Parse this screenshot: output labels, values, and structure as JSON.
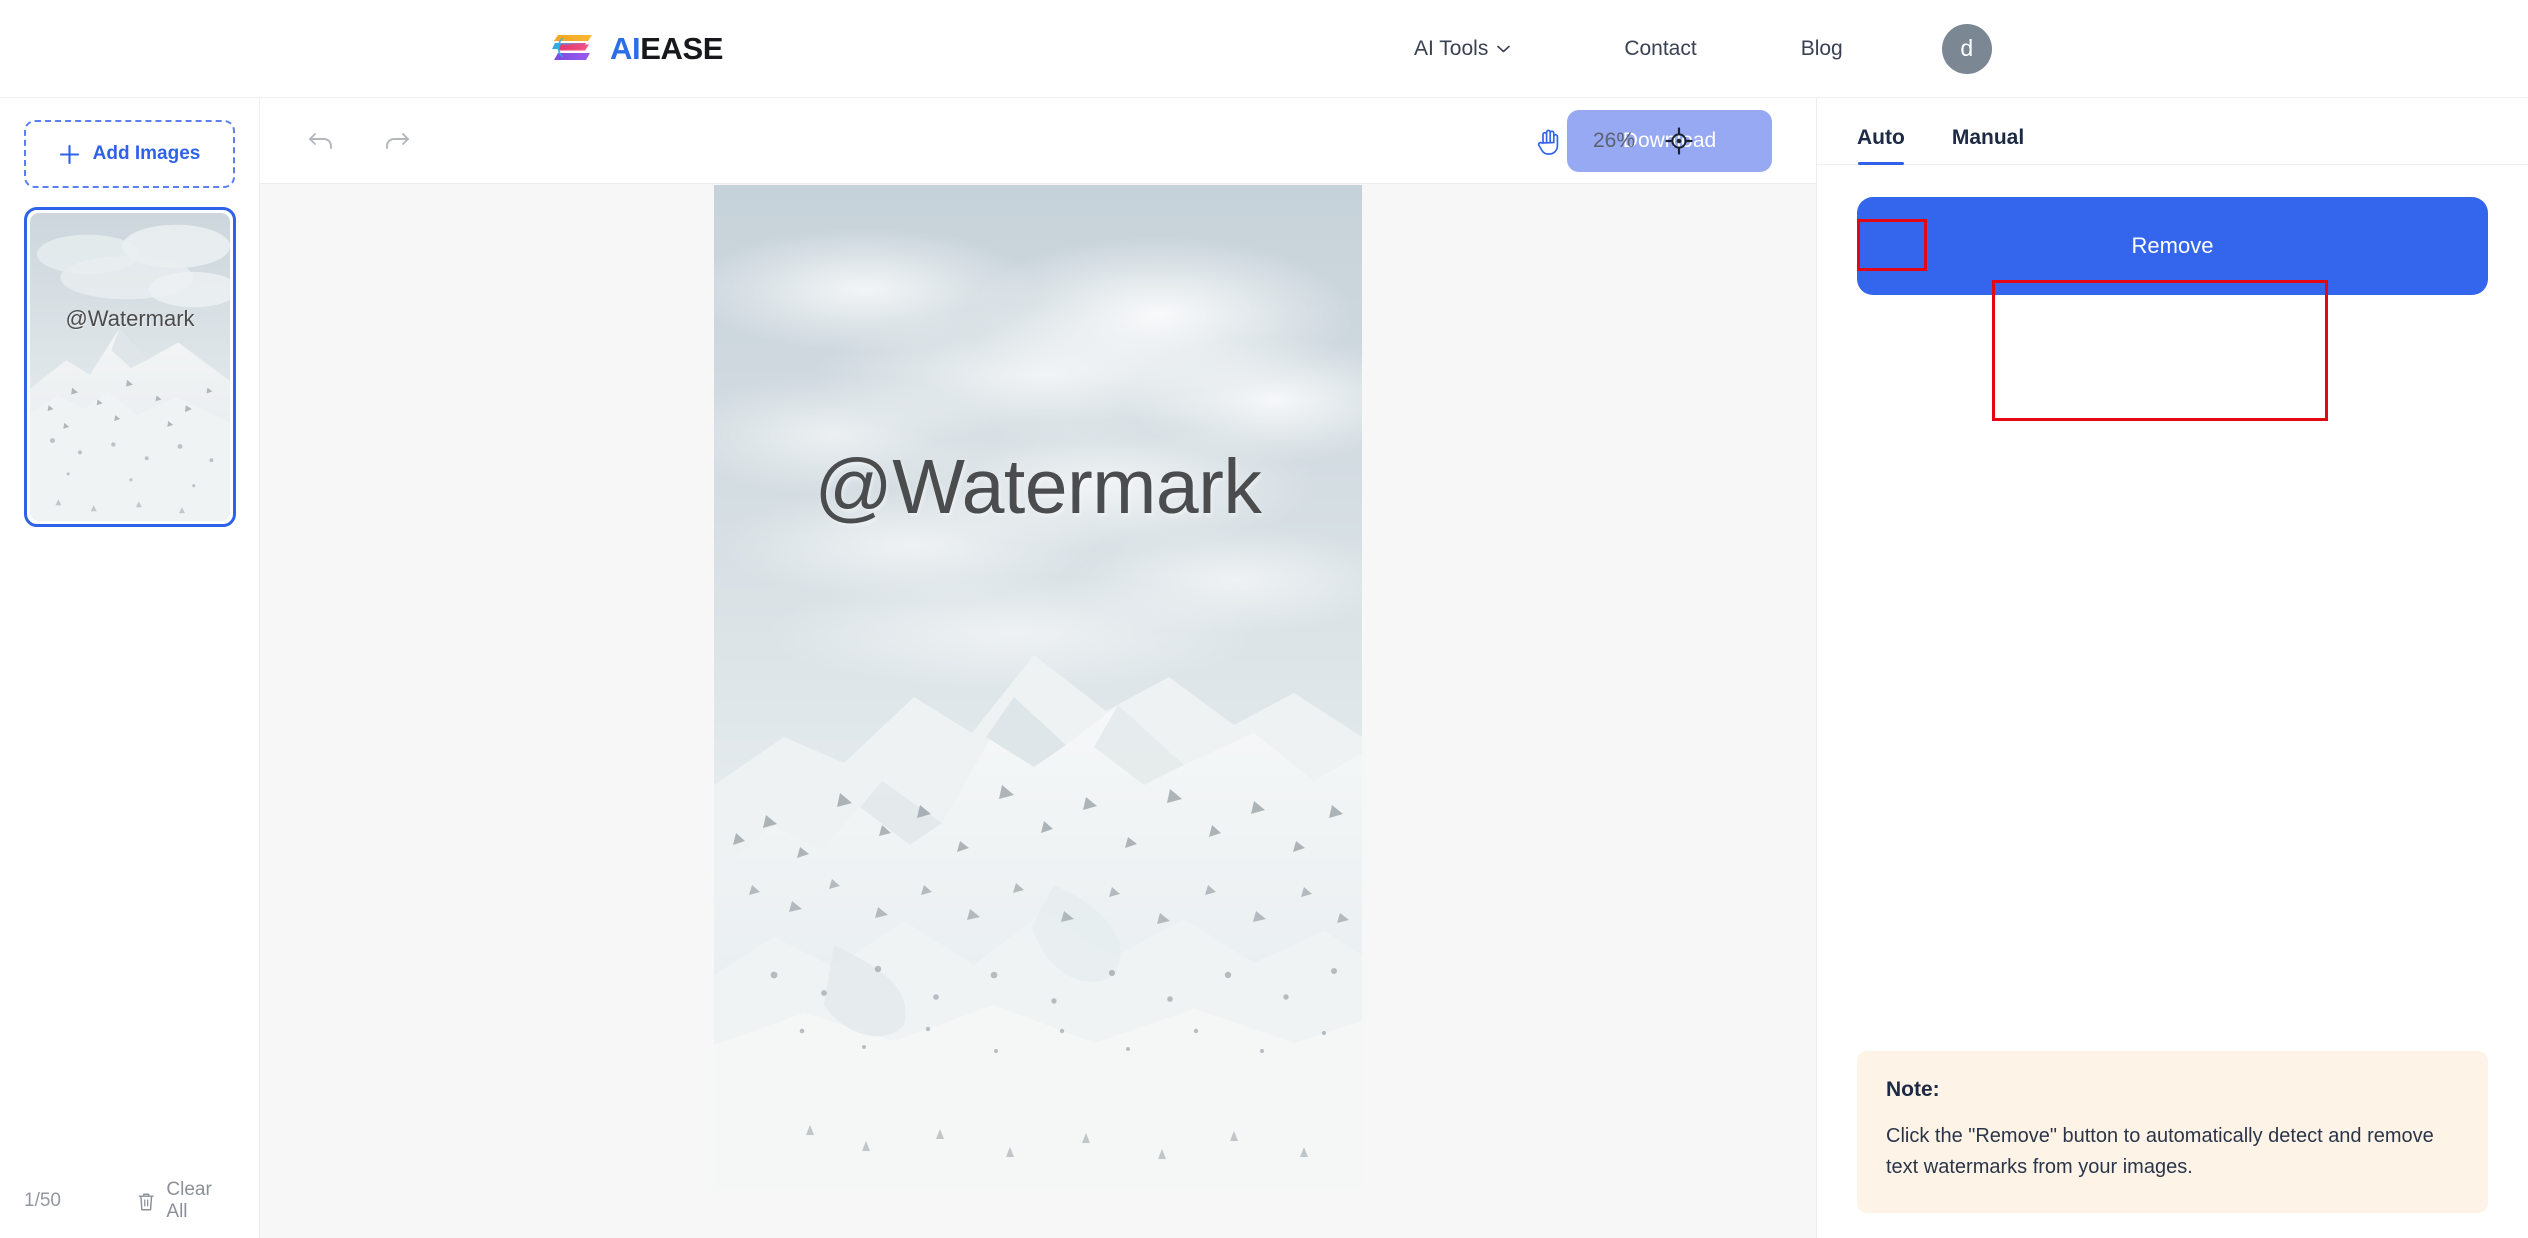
{
  "header": {
    "brand": {
      "part1": "AI",
      "part2": "EASE",
      "logo_icon": "aiease-logo-icon"
    },
    "nav": [
      {
        "label": "AI Tools",
        "has_chevron": true,
        "icon": "chevron-down-icon"
      },
      {
        "label": "Contact",
        "has_chevron": false
      },
      {
        "label": "Blog",
        "has_chevron": false
      }
    ],
    "avatar": {
      "initial": "d",
      "color": "#7c8794"
    }
  },
  "sidebar": {
    "add_images": {
      "label": "Add Images",
      "icon": "plus-icon"
    },
    "thumbnails": [
      {
        "watermark_text": "@Watermark",
        "selected": true
      }
    ],
    "footer": {
      "count": "1/50",
      "clear_all": "Clear All",
      "clear_icon": "trash-icon"
    }
  },
  "toolbar": {
    "undo": {
      "icon": "undo-icon",
      "label": "Undo",
      "enabled": false
    },
    "redo": {
      "icon": "redo-icon",
      "label": "Redo",
      "enabled": false
    },
    "pan_tool": {
      "icon": "hand-icon",
      "label": "Pan",
      "active": true,
      "color": "#3366ec"
    },
    "zoom_level": "26%",
    "fit_tool": {
      "icon": "target-icon",
      "label": "Fit to screen"
    },
    "download": {
      "label": "Download",
      "enabled": false,
      "color": "#96a9f2"
    }
  },
  "canvas": {
    "image": {
      "watermark_text": "@Watermark",
      "alt": "snowy mountain landscape"
    }
  },
  "right_panel": {
    "tabs": [
      {
        "label": "Auto",
        "active": true
      },
      {
        "label": "Manual",
        "active": false
      }
    ],
    "remove_button": {
      "label": "Remove",
      "color": "#3366ec"
    },
    "note": {
      "title": "Note:",
      "text": "Click the \"Remove\" button to automatically detect and remove text watermarks  from your images."
    }
  },
  "annotations": {
    "accent_color": "#e30613",
    "boxes": [
      {
        "name": "auto-tab-highlight"
      },
      {
        "name": "remove-button-highlight"
      }
    ]
  }
}
